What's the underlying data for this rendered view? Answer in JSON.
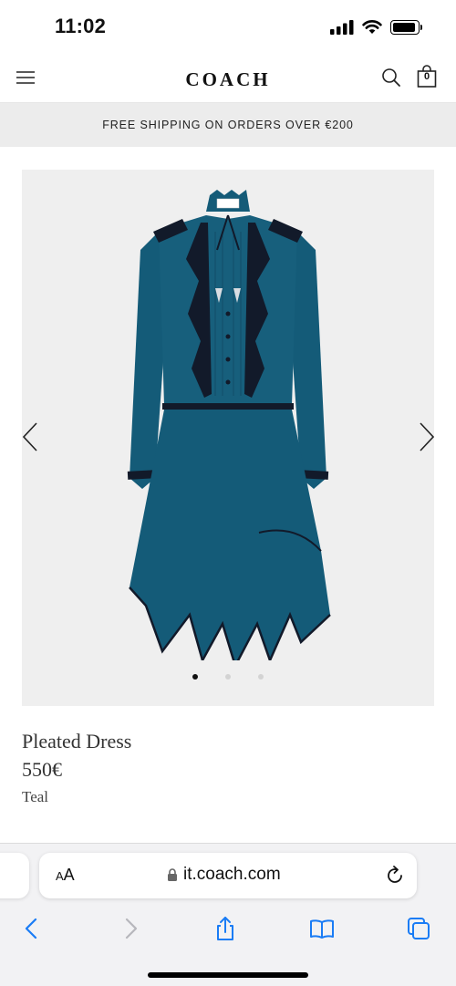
{
  "status_bar": {
    "time": "11:02"
  },
  "header": {
    "brand": "COACH",
    "bag_count": "0"
  },
  "promo": {
    "text": "FREE SHIPPING ON ORDERS OVER €200"
  },
  "product": {
    "title": "Pleated Dress",
    "price": "550€",
    "color": "Teal",
    "image": {
      "slide_count": 3,
      "active_slide": 1
    }
  },
  "browser": {
    "text_size_label": "A",
    "text_size_label_large": "A",
    "url": "it.coach.com"
  },
  "colors": {
    "dress_teal": "#145b78",
    "trim_navy": "#121a2a",
    "image_bg": "#efefef",
    "safari_blue": "#1a7cf5"
  }
}
